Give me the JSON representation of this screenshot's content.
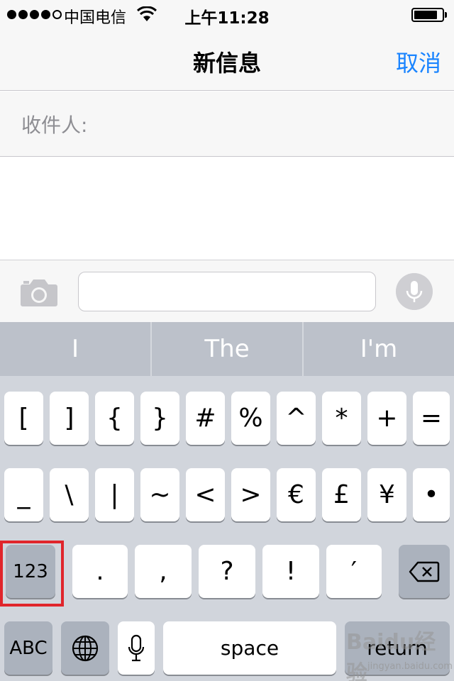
{
  "status_bar": {
    "carrier": "中国电信",
    "time": "上午11:28",
    "signal_bars": 4,
    "signal_total": 5,
    "battery_level": 0.85
  },
  "nav": {
    "title": "新信息",
    "cancel_label": "取消"
  },
  "recipient": {
    "label": "收件人:"
  },
  "input_bar": {
    "message_value": "",
    "icons": [
      "camera-icon",
      "microphone-icon"
    ]
  },
  "predictive": [
    "I",
    "The",
    "I'm"
  ],
  "keyboard": {
    "row1": [
      "[",
      "]",
      "{",
      "}",
      "#",
      "%",
      "^",
      "*",
      "+",
      "="
    ],
    "row2": [
      "_",
      "\\",
      "|",
      "~",
      "<",
      ">",
      "€",
      "£",
      "¥",
      "•"
    ],
    "row3": [
      "123",
      ".",
      ",",
      "?",
      "!",
      "′"
    ],
    "row4": {
      "abc": "ABC",
      "space": "space",
      "return": "return"
    },
    "icons": [
      "delete-icon",
      "globe-icon",
      "dictation-icon"
    ]
  },
  "highlight_color": "#e0252b",
  "accent_color": "#1a84ff",
  "watermark": {
    "brand": "Baidu经验",
    "url": "jingyan.baidu.com"
  }
}
